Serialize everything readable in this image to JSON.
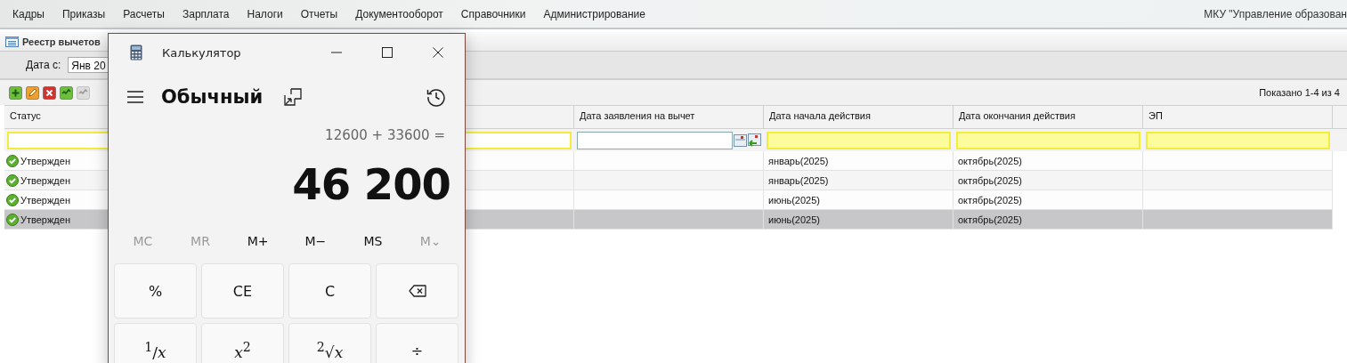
{
  "menu": {
    "items": [
      "Кадры",
      "Приказы",
      "Расчеты",
      "Зарплата",
      "Налоги",
      "Отчеты",
      "Документооборот",
      "Справочники",
      "Администрирование"
    ],
    "organization": "МКУ \"Управление образован"
  },
  "panel": {
    "title": "Реестр вычетов"
  },
  "filter": {
    "label": "Дата с:",
    "value": "Янв 20"
  },
  "toolbar": {
    "buttons": [
      {
        "kind": "add",
        "disabled": false
      },
      {
        "kind": "edit",
        "disabled": false
      },
      {
        "kind": "delete",
        "disabled": false
      },
      {
        "kind": "approve",
        "disabled": false
      },
      {
        "kind": "approve",
        "disabled": true
      }
    ],
    "paging": "Показано 1-4 из 4"
  },
  "table": {
    "columns": [
      "Статус",
      "Дата заявления на вычет",
      "Дата начала действия",
      "Дата окончания действия",
      "ЭП"
    ],
    "rows": [
      {
        "status": "Утвержден",
        "start": "январь(2025)",
        "end": "октябрь(2025)",
        "selected": false
      },
      {
        "status": "Утвержден",
        "start": "январь(2025)",
        "end": "октябрь(2025)",
        "selected": false
      },
      {
        "status": "Утвержден",
        "start": "июнь(2025)",
        "end": "октябрь(2025)",
        "selected": false
      },
      {
        "status": "Утвержден",
        "start": "июнь(2025)",
        "end": "октябрь(2025)",
        "selected": true
      }
    ]
  },
  "calculator": {
    "title": "Калькулятор",
    "mode": "Обычный",
    "expression": "12600 + 33600 =",
    "result": "46 200",
    "memory": [
      {
        "label": "MC",
        "disabled": true
      },
      {
        "label": "MR",
        "disabled": true
      },
      {
        "label": "M+",
        "disabled": false
      },
      {
        "label": "M−",
        "disabled": false
      },
      {
        "label": "MS",
        "disabled": false
      },
      {
        "label": "M⌄",
        "disabled": true
      }
    ],
    "keys": [
      {
        "kind": "text",
        "label": "%"
      },
      {
        "kind": "text",
        "label": "CE"
      },
      {
        "kind": "text",
        "label": "C"
      },
      {
        "kind": "backspace"
      },
      {
        "kind": "math",
        "label": "$^{1}$/*x*"
      },
      {
        "kind": "math",
        "label": "*x*$^{2}$"
      },
      {
        "kind": "math",
        "label": "$^{2}$√*x*"
      },
      {
        "kind": "text",
        "label": "÷"
      }
    ]
  }
}
